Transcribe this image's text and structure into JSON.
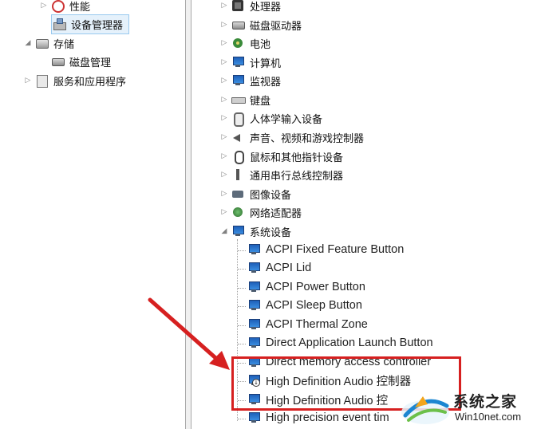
{
  "left_tree": {
    "items": [
      {
        "label": "性能",
        "icon": "performance-icon"
      },
      {
        "label": "设备管理器",
        "icon": "device-manager-icon",
        "selected": true
      },
      {
        "label": "存储",
        "icon": "storage-icon"
      },
      {
        "label": "磁盘管理",
        "icon": "disk-management-icon"
      },
      {
        "label": "服务和应用程序",
        "icon": "services-icon"
      }
    ]
  },
  "device_tree": {
    "categories": [
      {
        "label": "处理器",
        "icon": "processor-icon"
      },
      {
        "label": "磁盘驱动器",
        "icon": "disk-drive-icon"
      },
      {
        "label": "电池",
        "icon": "battery-icon"
      },
      {
        "label": "计算机",
        "icon": "computer-icon"
      },
      {
        "label": "监视器",
        "icon": "monitor-icon"
      },
      {
        "label": "键盘",
        "icon": "keyboard-icon"
      },
      {
        "label": "人体学输入设备",
        "icon": "hid-icon"
      },
      {
        "label": "声音、视频和游戏控制器",
        "icon": "sound-icon"
      },
      {
        "label": "鼠标和其他指针设备",
        "icon": "mouse-icon"
      },
      {
        "label": "通用串行总线控制器",
        "icon": "usb-icon"
      },
      {
        "label": "图像设备",
        "icon": "imaging-icon"
      },
      {
        "label": "网络适配器",
        "icon": "network-icon"
      },
      {
        "label": "系统设备",
        "icon": "system-devices-icon",
        "expanded": true
      }
    ],
    "system_devices": [
      "ACPI Fixed Feature Button",
      "ACPI Lid",
      "ACPI Power Button",
      "ACPI Sleep Button",
      "ACPI Thermal Zone",
      "Direct Application Launch Button",
      "Direct memory access controller",
      "High Definition Audio 控制器",
      "High Definition Audio 控",
      "High precision event tim"
    ]
  },
  "annotation": {
    "color": "#d62020"
  },
  "watermark": {
    "title": "系统之家",
    "subtitle": "Win10net.com"
  }
}
